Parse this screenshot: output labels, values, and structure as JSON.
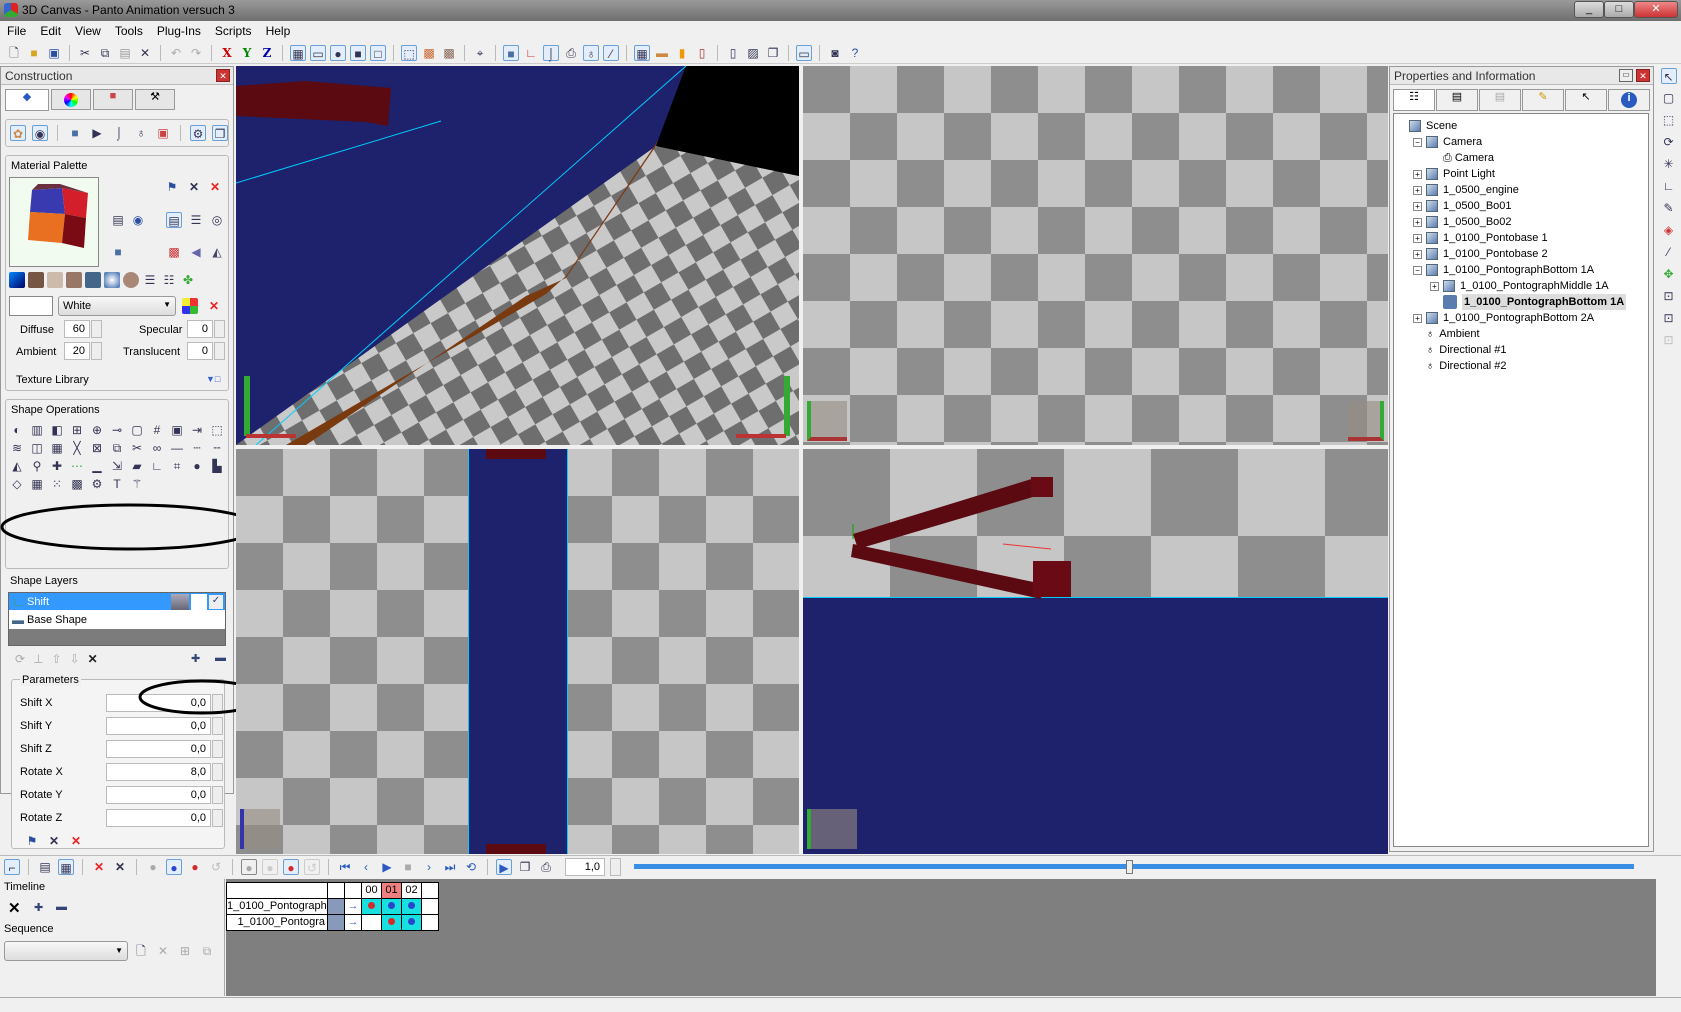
{
  "window": {
    "title": "3D Canvas - Panto Animation versuch 3",
    "minimize": "_",
    "maximize": "□",
    "close": "✕"
  },
  "menu": [
    "File",
    "Edit",
    "View",
    "Tools",
    "Plug-Ins",
    "Scripts",
    "Help"
  ],
  "toolbar": {
    "x_label": "X",
    "y_label": "Y",
    "z_label": "Z"
  },
  "construction": {
    "title": "Construction",
    "material_palette": {
      "title": "Material Palette",
      "color_name": "White",
      "diffuse_label": "Diffuse",
      "diffuse": "60",
      "ambient_label": "Ambient",
      "ambient": "20",
      "specular_label": "Specular",
      "specular": "0",
      "translucent_label": "Translucent",
      "translucent": "0",
      "texture_library": "Texture Library"
    },
    "shape_operations": {
      "title": "Shape Operations"
    },
    "shape_layers": {
      "title": "Shape Layers",
      "layers": [
        "Shift",
        "Base Shape"
      ]
    },
    "parameters": {
      "title": "Parameters",
      "rows": [
        {
          "label": "Shift X",
          "value": "0,0"
        },
        {
          "label": "Shift Y",
          "value": "0,0"
        },
        {
          "label": "Shift Z",
          "value": "0,0"
        },
        {
          "label": "Rotate X",
          "value": "8,0"
        },
        {
          "label": "Rotate Y",
          "value": "0,0"
        },
        {
          "label": "Rotate Z",
          "value": "0,0"
        }
      ]
    }
  },
  "properties": {
    "title": "Properties and Information",
    "tree": [
      {
        "label": "Scene"
      },
      {
        "label": "Camera"
      },
      {
        "label": "Camera"
      },
      {
        "label": "Point Light"
      },
      {
        "label": "1_0500_engine"
      },
      {
        "label": "1_0500_Bo01"
      },
      {
        "label": "1_0500_Bo02"
      },
      {
        "label": "1_0100_Pontobase 1"
      },
      {
        "label": "1_0100_Pontobase 2"
      },
      {
        "label": "1_0100_PontographBottom 1A"
      },
      {
        "label": "1_0100_PontographMiddle 1A"
      },
      {
        "label": "1_0100_PontographBottom 1A"
      },
      {
        "label": "1_0100_PontographBottom 2A"
      },
      {
        "label": "Ambient"
      },
      {
        "label": "Directional #1"
      },
      {
        "label": "Directional #2"
      }
    ]
  },
  "animation": {
    "speed": "1,0",
    "timeline_label": "Timeline",
    "sequence_label": "Sequence",
    "sequence_value": "",
    "frames": [
      "00",
      "01",
      "02"
    ],
    "rows": [
      {
        "name": "1_0100_Pontograph"
      },
      {
        "name": "1_0100_Pontogra"
      }
    ],
    "colors": {
      "key_red": "#d42a2a",
      "key_blue": "#2a45c8",
      "cell": "#19e0e0",
      "current_frame": "#f08080"
    }
  },
  "colors": {
    "navy": "#1e216b",
    "brown": "#7a3a10",
    "dark_red": "#5a0a10"
  }
}
